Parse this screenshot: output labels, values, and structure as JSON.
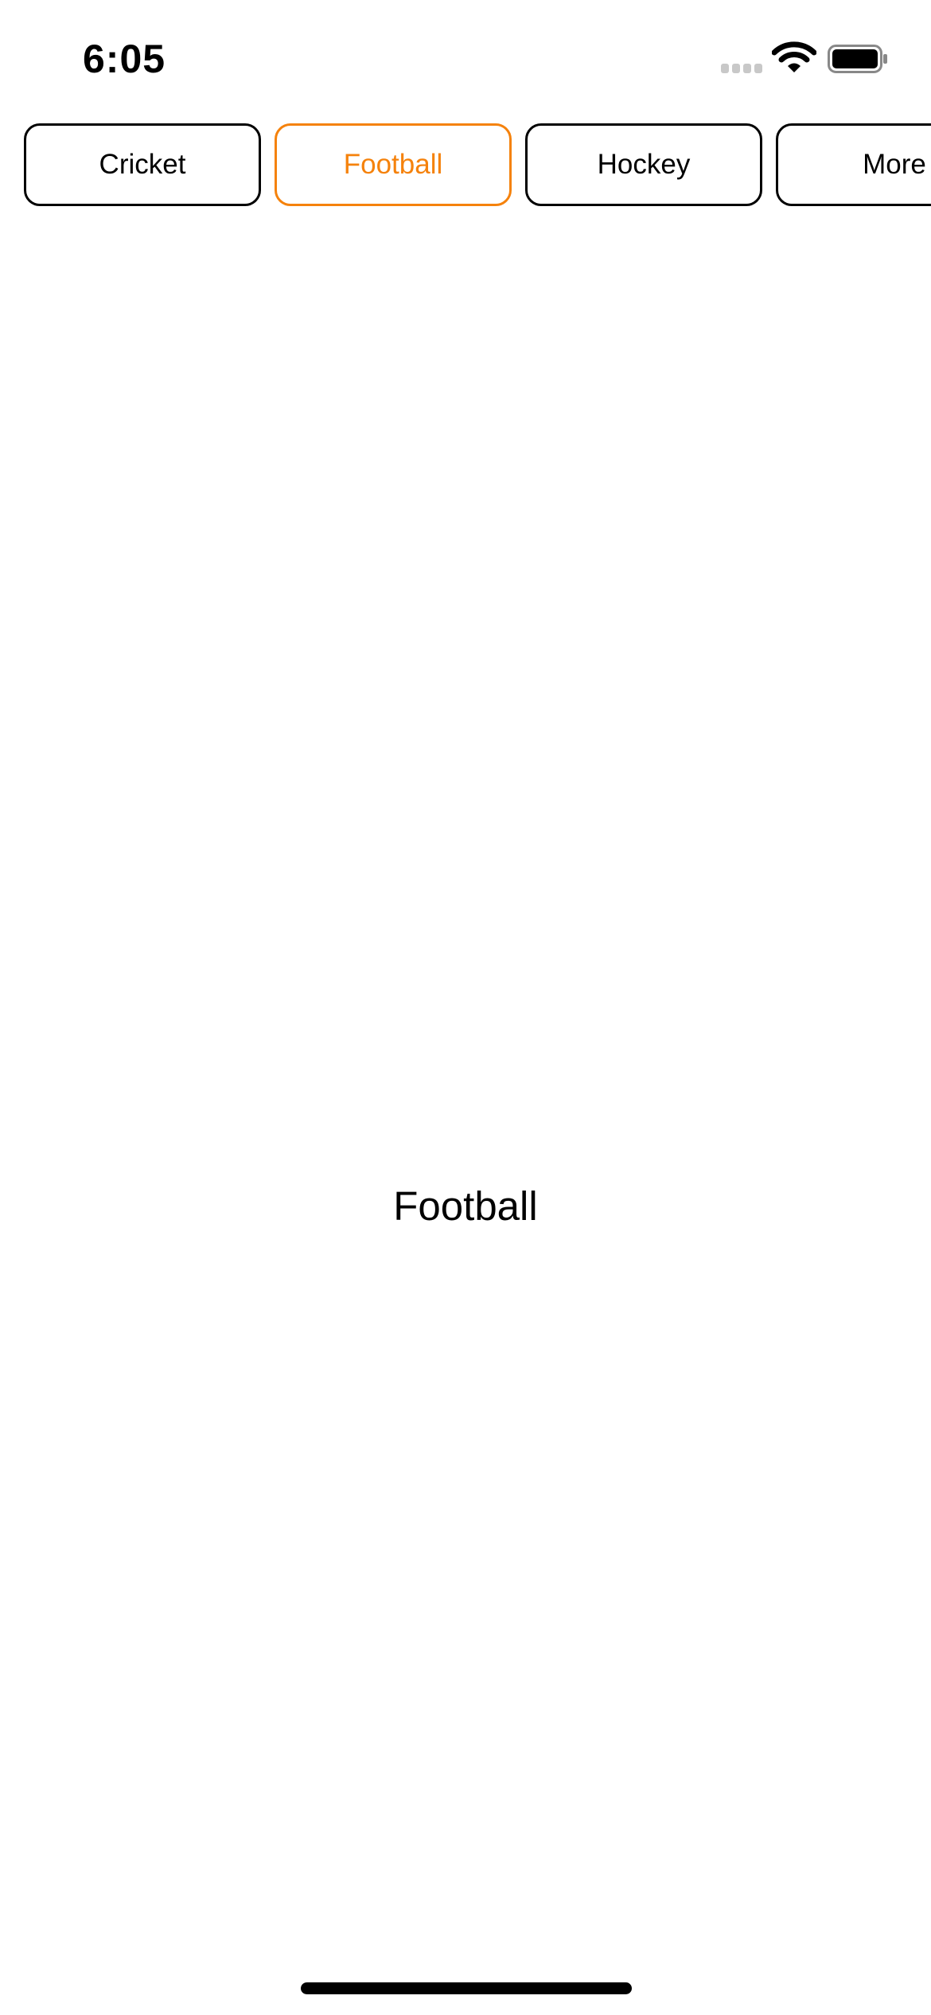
{
  "status_bar": {
    "time": "6:05",
    "icons": [
      "signal-icon",
      "wifi-icon",
      "battery-icon"
    ]
  },
  "tabs": [
    {
      "label": "Cricket",
      "active": false
    },
    {
      "label": "Football",
      "active": true
    },
    {
      "label": "Hockey",
      "active": false
    },
    {
      "label": "More",
      "active": false
    }
  ],
  "main": {
    "content_label": "Football"
  },
  "colors": {
    "accent": "#f5820c",
    "text": "#000000",
    "background": "#ffffff"
  }
}
